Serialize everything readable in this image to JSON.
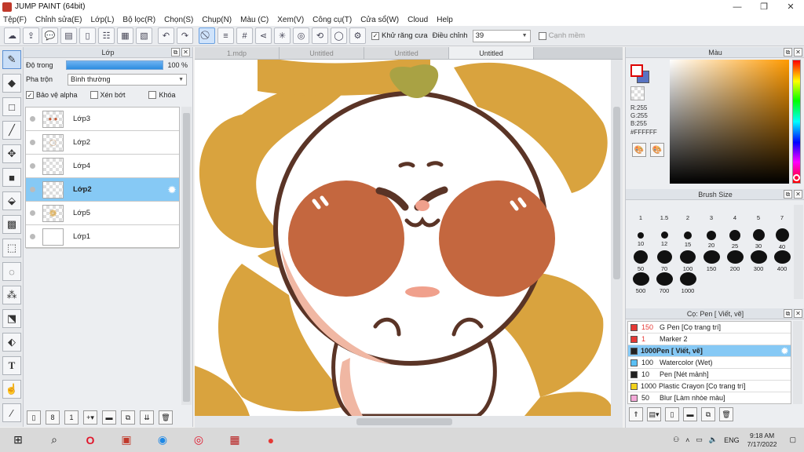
{
  "window": {
    "title": "JUMP PAINT (64bit)",
    "minimize": "—",
    "maximize": "❐",
    "close": "✕"
  },
  "menu": [
    "Tệp(F)",
    "Chỉnh sửa(E)",
    "Lớp(L)",
    "Bộ lọc(R)",
    "Chọn(S)",
    "Chụp(N)",
    "Màu (C)",
    "Xem(V)",
    "Công cụ(T)",
    "Cửa sổ(W)",
    "Cloud",
    "Help"
  ],
  "toolbar": {
    "antialias_label": "Khử răng cưa",
    "correction_label": "Điều chỉnh",
    "correction_value": "39",
    "sharp_edge_label": "Cạnh mềm"
  },
  "layer_panel": {
    "title": "Lớp",
    "opacity_label": "Độ trong",
    "opacity_value": "100 %",
    "opacity_fraction": 1.0,
    "blend_label": "Pha trộn",
    "blend_value": "Bình thường",
    "protect_alpha_label": "Bảo vệ alpha",
    "clip_label": "Xén bớt",
    "lock_label": "Khóa",
    "layers": [
      {
        "name": "Lớp3",
        "selected": false
      },
      {
        "name": "Lớp2",
        "selected": false
      },
      {
        "name": "Lớp4",
        "selected": false
      },
      {
        "name": "Lớp2",
        "selected": true
      },
      {
        "name": "Lớp5",
        "selected": false
      },
      {
        "name": "Lớp1",
        "selected": false
      }
    ]
  },
  "documents": {
    "tabs": [
      "1.mdp",
      "Untitled",
      "Untitled",
      "Untitled"
    ],
    "active_tab_index": 3
  },
  "color_panel": {
    "title": "Màu",
    "r": "R:255",
    "g": "G:255",
    "b": "B:255",
    "hex": "#FFFFFF",
    "foreground": "#ffffff",
    "background": "#5873c2"
  },
  "brush_size": {
    "title": "Brush Size",
    "sizes": [
      "1",
      "1.5",
      "2",
      "3",
      "4",
      "5",
      "7",
      "10",
      "12",
      "15",
      "20",
      "25",
      "30",
      "40",
      "50",
      "70",
      "100",
      "150",
      "200",
      "300",
      "400",
      "500",
      "700",
      "1000"
    ]
  },
  "pen_panel": {
    "title": "Cọ: Pen [ Viết, vẽ]",
    "pens": [
      {
        "size": "150",
        "name": "G Pen [Cọ trang trí]",
        "color": "#e53935",
        "selected": false
      },
      {
        "size": "1",
        "name": "Marker 2",
        "color": "#e53935",
        "selected": false
      },
      {
        "size": "1000",
        "name": "Pen [ Viết, vẽ]",
        "color": "#222222",
        "selected": true
      },
      {
        "size": "100",
        "name": "Watercolor (Wet)",
        "color": "#5bc0f5",
        "selected": false
      },
      {
        "size": "10",
        "name": "Pen [Nét mảnh]",
        "color": "#222222",
        "selected": false
      },
      {
        "size": "1000",
        "name": "Plastic Crayon [Cọ trang trí]",
        "color": "#f2d21b",
        "selected": false
      },
      {
        "size": "50",
        "name": "Blur [Làm nhòe màu]",
        "color": "#f4a9d8",
        "selected": false
      }
    ]
  },
  "taskbar": {
    "tray_lang": "ENG",
    "time": "9:18 AM",
    "date": "7/17/2022"
  }
}
